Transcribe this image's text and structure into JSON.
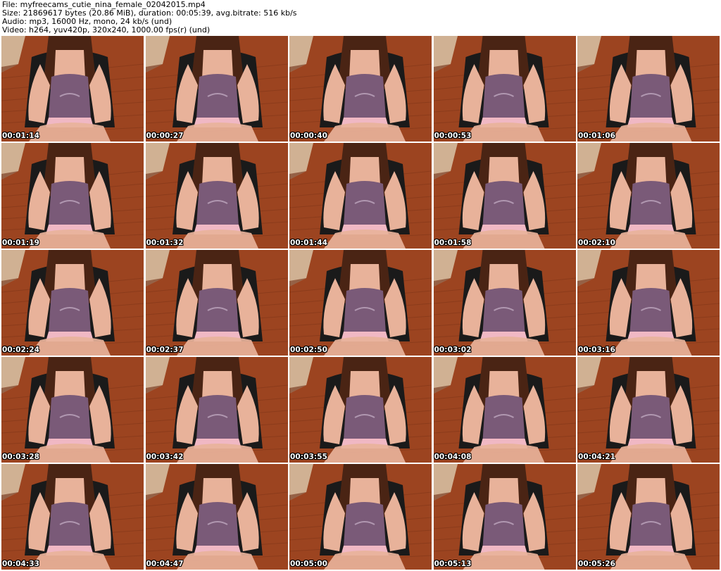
{
  "info": {
    "lines": [
      "File: myfreecams_cutie_nina_female_02042015.mp4",
      "Size: 21869617 bytes (20.86 MiB), duration: 00:05:39, avg.bitrate: 516 kb/s",
      "Audio: mp3, 16000 Hz, mono, 24 kb/s (und)",
      "Video: h264, yuv420p, 320x240, 1000.00 fps(r) (und)"
    ]
  },
  "colors": {
    "floor": "#9c4420",
    "floor_dark": "#6e2c12",
    "wall": "#d9c4a8",
    "chair": "#1a1a1a",
    "hair": "#4a2414",
    "skin": "#e8b29a",
    "top": "#7a5a78",
    "shorts": "#f0b8c4"
  },
  "thumbnails": [
    {
      "timestamp": "00:01:14"
    },
    {
      "timestamp": "00:00:27"
    },
    {
      "timestamp": "00:00:40"
    },
    {
      "timestamp": "00:00:53"
    },
    {
      "timestamp": "00:01:06"
    },
    {
      "timestamp": "00:01:19"
    },
    {
      "timestamp": "00:01:32"
    },
    {
      "timestamp": "00:01:44"
    },
    {
      "timestamp": "00:01:58"
    },
    {
      "timestamp": "00:02:10"
    },
    {
      "timestamp": "00:02:24"
    },
    {
      "timestamp": "00:02:37"
    },
    {
      "timestamp": "00:02:50"
    },
    {
      "timestamp": "00:03:02"
    },
    {
      "timestamp": "00:03:16"
    },
    {
      "timestamp": "00:03:28"
    },
    {
      "timestamp": "00:03:42"
    },
    {
      "timestamp": "00:03:55"
    },
    {
      "timestamp": "00:04:08"
    },
    {
      "timestamp": "00:04:21"
    },
    {
      "timestamp": "00:04:33"
    },
    {
      "timestamp": "00:04:47"
    },
    {
      "timestamp": "00:05:00"
    },
    {
      "timestamp": "00:05:13"
    },
    {
      "timestamp": "00:05:26"
    }
  ]
}
